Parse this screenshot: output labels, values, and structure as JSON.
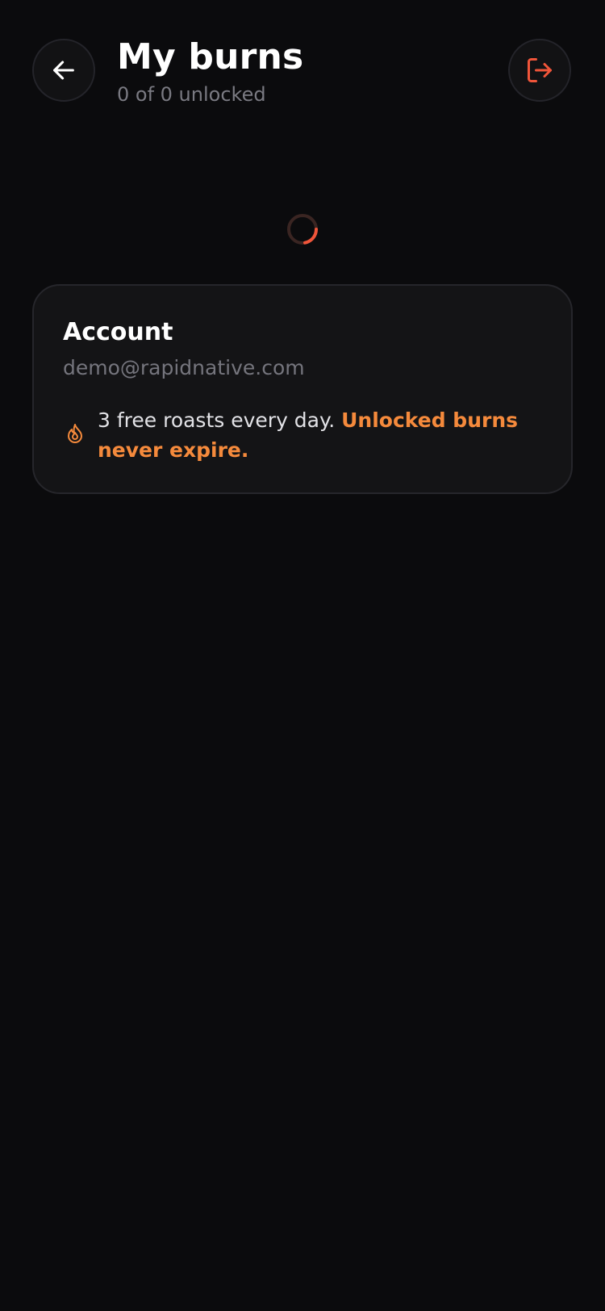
{
  "header": {
    "title": "My burns",
    "subtitle": "0 of 0 unlocked",
    "back_icon": "arrow-left-icon",
    "logout_icon": "log-out-icon"
  },
  "loading": {
    "icon": "loading-spinner-icon"
  },
  "account": {
    "heading": "Account",
    "email": "demo@rapidnative.com",
    "info_icon": "flame-icon",
    "info_text": "3 free roasts every day. ",
    "info_highlight": "Unlocked burns never expire."
  },
  "colors": {
    "background": "#0b0b0d",
    "card": "#141416",
    "accent_orange": "#f58a3c",
    "accent_red": "#f0553a",
    "muted_text": "#75757d"
  }
}
